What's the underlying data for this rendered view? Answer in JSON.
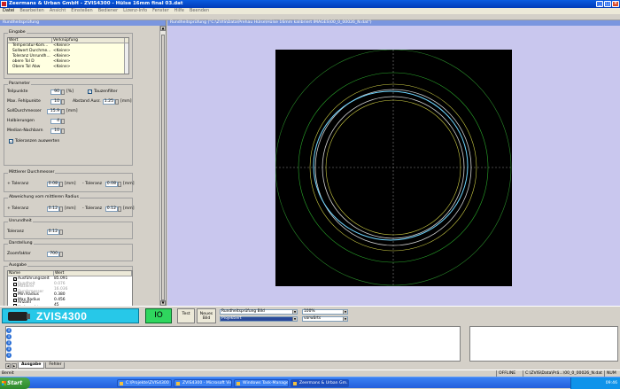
{
  "window": {
    "title": "Zeermans & Urban GmbH - ZVIS4300 - Hülse 16mm final 03.dat"
  },
  "menu": [
    "Datei",
    "Bearbeiten",
    "Ansicht",
    "Einstellen",
    "Bediener",
    "Lizenz-Info",
    "Fenster",
    "Hilfe",
    "Beenden"
  ],
  "left_panel": {
    "title": "Rundheitsprüfung",
    "eingabe": {
      "label": "Eingabe",
      "col_wert": "Wert",
      "col_verknuepfung": "Verknüpfung",
      "rows": [
        {
          "name": "Temperatur-Kom...",
          "value": "<Keine>"
        },
        {
          "name": "Sollwert Durchme...",
          "value": "<Keine>"
        },
        {
          "name": "Toleranz Unrundh...",
          "value": "<Keine>"
        },
        {
          "name": "obere Tol D",
          "value": "<Keine>"
        },
        {
          "name": "Obere Tol Abw",
          "value": "<Keine>"
        }
      ]
    },
    "parameter": {
      "label": "Parameter",
      "teilpunkte_label": "Teilpunkte",
      "teilpunkte_value": "90",
      "teilpunkte_unit": "[%]",
      "tauzenfilter_label": "Tauzenfilter",
      "max_fehl_label": "Max. Fehlpunkte",
      "max_fehl_value": "10",
      "abstand_label": "Abstand Ausr.",
      "abstand_value": "1.25",
      "abstand_unit": "[mm]",
      "soll_label": "SollDurchmesser",
      "soll_value": "15.9",
      "soll_unit": "[mm]",
      "halb_label": "Halbierungen",
      "halb_value": "4",
      "median_label": "Median-Nachbarn",
      "median_value": "10",
      "tol_auswerten_label": "Toleranzen auswerten"
    },
    "mittlerer_d": {
      "label": "Mittlerer Durchmesser",
      "plus_label": "+ Toleranz",
      "plus_value": "0.08",
      "plus_unit": "[mm]",
      "minus_label": "- Toleranz",
      "minus_value": "0.08",
      "minus_unit": "[mm]"
    },
    "abweichung": {
      "label": "Abweichung vom mittleren Radius",
      "plus_label": "+ Toleranz",
      "plus_value": "0.12",
      "plus_unit": "[mm]",
      "minus_label": "- Toleranz",
      "minus_value": "0.12",
      "minus_unit": "[mm]"
    },
    "unrundheit": {
      "label": "Unrundheit",
      "tol_label": "Toleranz",
      "tol_value": "0.12"
    },
    "darstellung": {
      "label": "Darstellung",
      "zoom_label": "Zoomfaktor",
      "zoom_value": "700"
    },
    "ausgabe": {
      "label": "Ausgabe",
      "col_name": "Name",
      "col_wert": "Wert",
      "rows": [
        {
          "name": "Ausführungszeit",
          "value": "85.091",
          "dim": false
        },
        {
          "name": "Rundheit",
          "value": "0.076",
          "dim": true
        },
        {
          "name": "Mittlerer Durchmesser",
          "value": "16.036",
          "dim": true
        },
        {
          "name": "Min Radius",
          "value": "0.380",
          "dim": false
        },
        {
          "name": "Max Radius",
          "value": "0.456",
          "dim": false
        },
        {
          "name": "Anzahl Kreispunkte",
          "value": "45",
          "dim": false
        }
      ]
    }
  },
  "right_panel": {
    "title": "Rundheitsprüfung (\"C:\\ZVIS\\Data\\Prehau Hülse\\Hülse 16mm kalibriert IMAGES\\00_0_00026_N.dat\")"
  },
  "bottom": {
    "logo_text": "ZVIS4300",
    "io_label": "IO",
    "test_label": "Test",
    "neues_bild_label": "Neues Bild",
    "combo1": "Rundheitsprüfung Bild",
    "combo2": "Projektiert",
    "combo3": "100%",
    "combo4": "vorwärts"
  },
  "log": {
    "tabs": [
      "Ausgabe",
      "Fehler"
    ]
  },
  "status": {
    "left": "Bereit",
    "mode": "OFFLINE",
    "path": "C:\\ZVIS\\Data\\Prä...\\00_0_00026_N.dat",
    "num": "NUM"
  },
  "taskbar": {
    "start": "Start",
    "items": [
      "C:\\Projekte\\ZVIS4300",
      "ZVIS4300 - Microsoft Vis...",
      "Windows Task-Manager",
      "Zeermans & Urban Gm..."
    ],
    "clock": "09:46"
  },
  "colors": {
    "io_green": "#2fd65e",
    "logo_cyan": "#27c8e8",
    "plot_bg": "#000000"
  }
}
